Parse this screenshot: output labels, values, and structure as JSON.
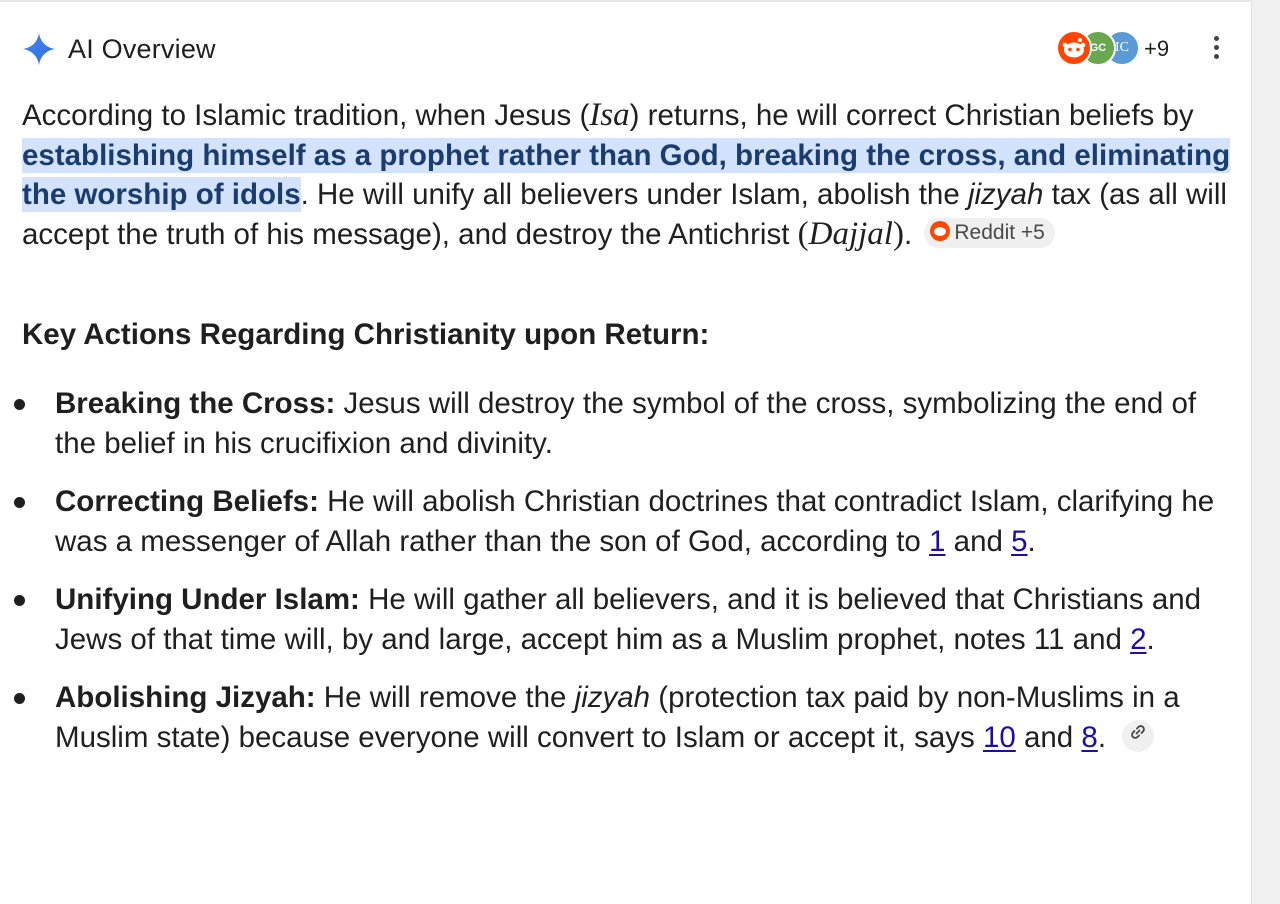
{
  "header": {
    "title": "AI Overview",
    "avatars": [
      "reddit",
      "GC",
      "IC"
    ],
    "more_count": "+9"
  },
  "intro": {
    "p1": "According to Islamic tradition, when Jesus (",
    "isa": "Isa",
    "p2": ") returns, he will correct Christian beliefs by ",
    "highlight": "establishing himself as a prophet rather than God, breaking the cross, and eliminating the worship of idols",
    "p3": ". He will unify all believers under Islam, abolish the ",
    "jizyah": "jizyah",
    "p4": " tax (as all will accept the truth of his message), and destroy the Antichrist ",
    "dajjal_open": "(",
    "dajjal": "Dajjal",
    "dajjal_close": ")",
    "p5": ".",
    "source_chip": "Reddit +5"
  },
  "section_title": "Key Actions Regarding Christianity upon Return:",
  "bullets": [
    {
      "title": "Breaking the Cross:",
      "text": " Jesus will destroy the symbol of the cross, symbolizing the end of the belief in his crucifixion and divinity."
    },
    {
      "title": "Correcting Beliefs:",
      "text": " He will abolish Christian doctrines that contradict Islam, clarifying he was a messenger of Allah rather than the son of God, according to ",
      "ref1": "1",
      "mid": " and ",
      "ref2": "5",
      "end": "."
    },
    {
      "title": "Unifying Under Islam:",
      "text": " He will gather all believers, and it is believed that Christians and Jews of that time will, by and large, accept him as a Muslim prophet, notes 11 and ",
      "ref1": "2",
      "end": "."
    },
    {
      "title": "Abolishing Jizyah:",
      "text": " He will remove the ",
      "jizyah": "jizyah",
      "text2": " (protection tax paid by non-Muslims in a Muslim state) because everyone will convert to Islam or accept it, says ",
      "ref1": "10",
      "mid": " and ",
      "ref2": "8",
      "end": "."
    }
  ],
  "icons": {
    "sparkle": "gemini-sparkle-icon",
    "kebab": "more-vert-icon",
    "link": "link-icon"
  },
  "colors": {
    "highlight_bg": "#d3e3fd",
    "link": "#1a0dab",
    "sparkle": "#4285f4"
  }
}
